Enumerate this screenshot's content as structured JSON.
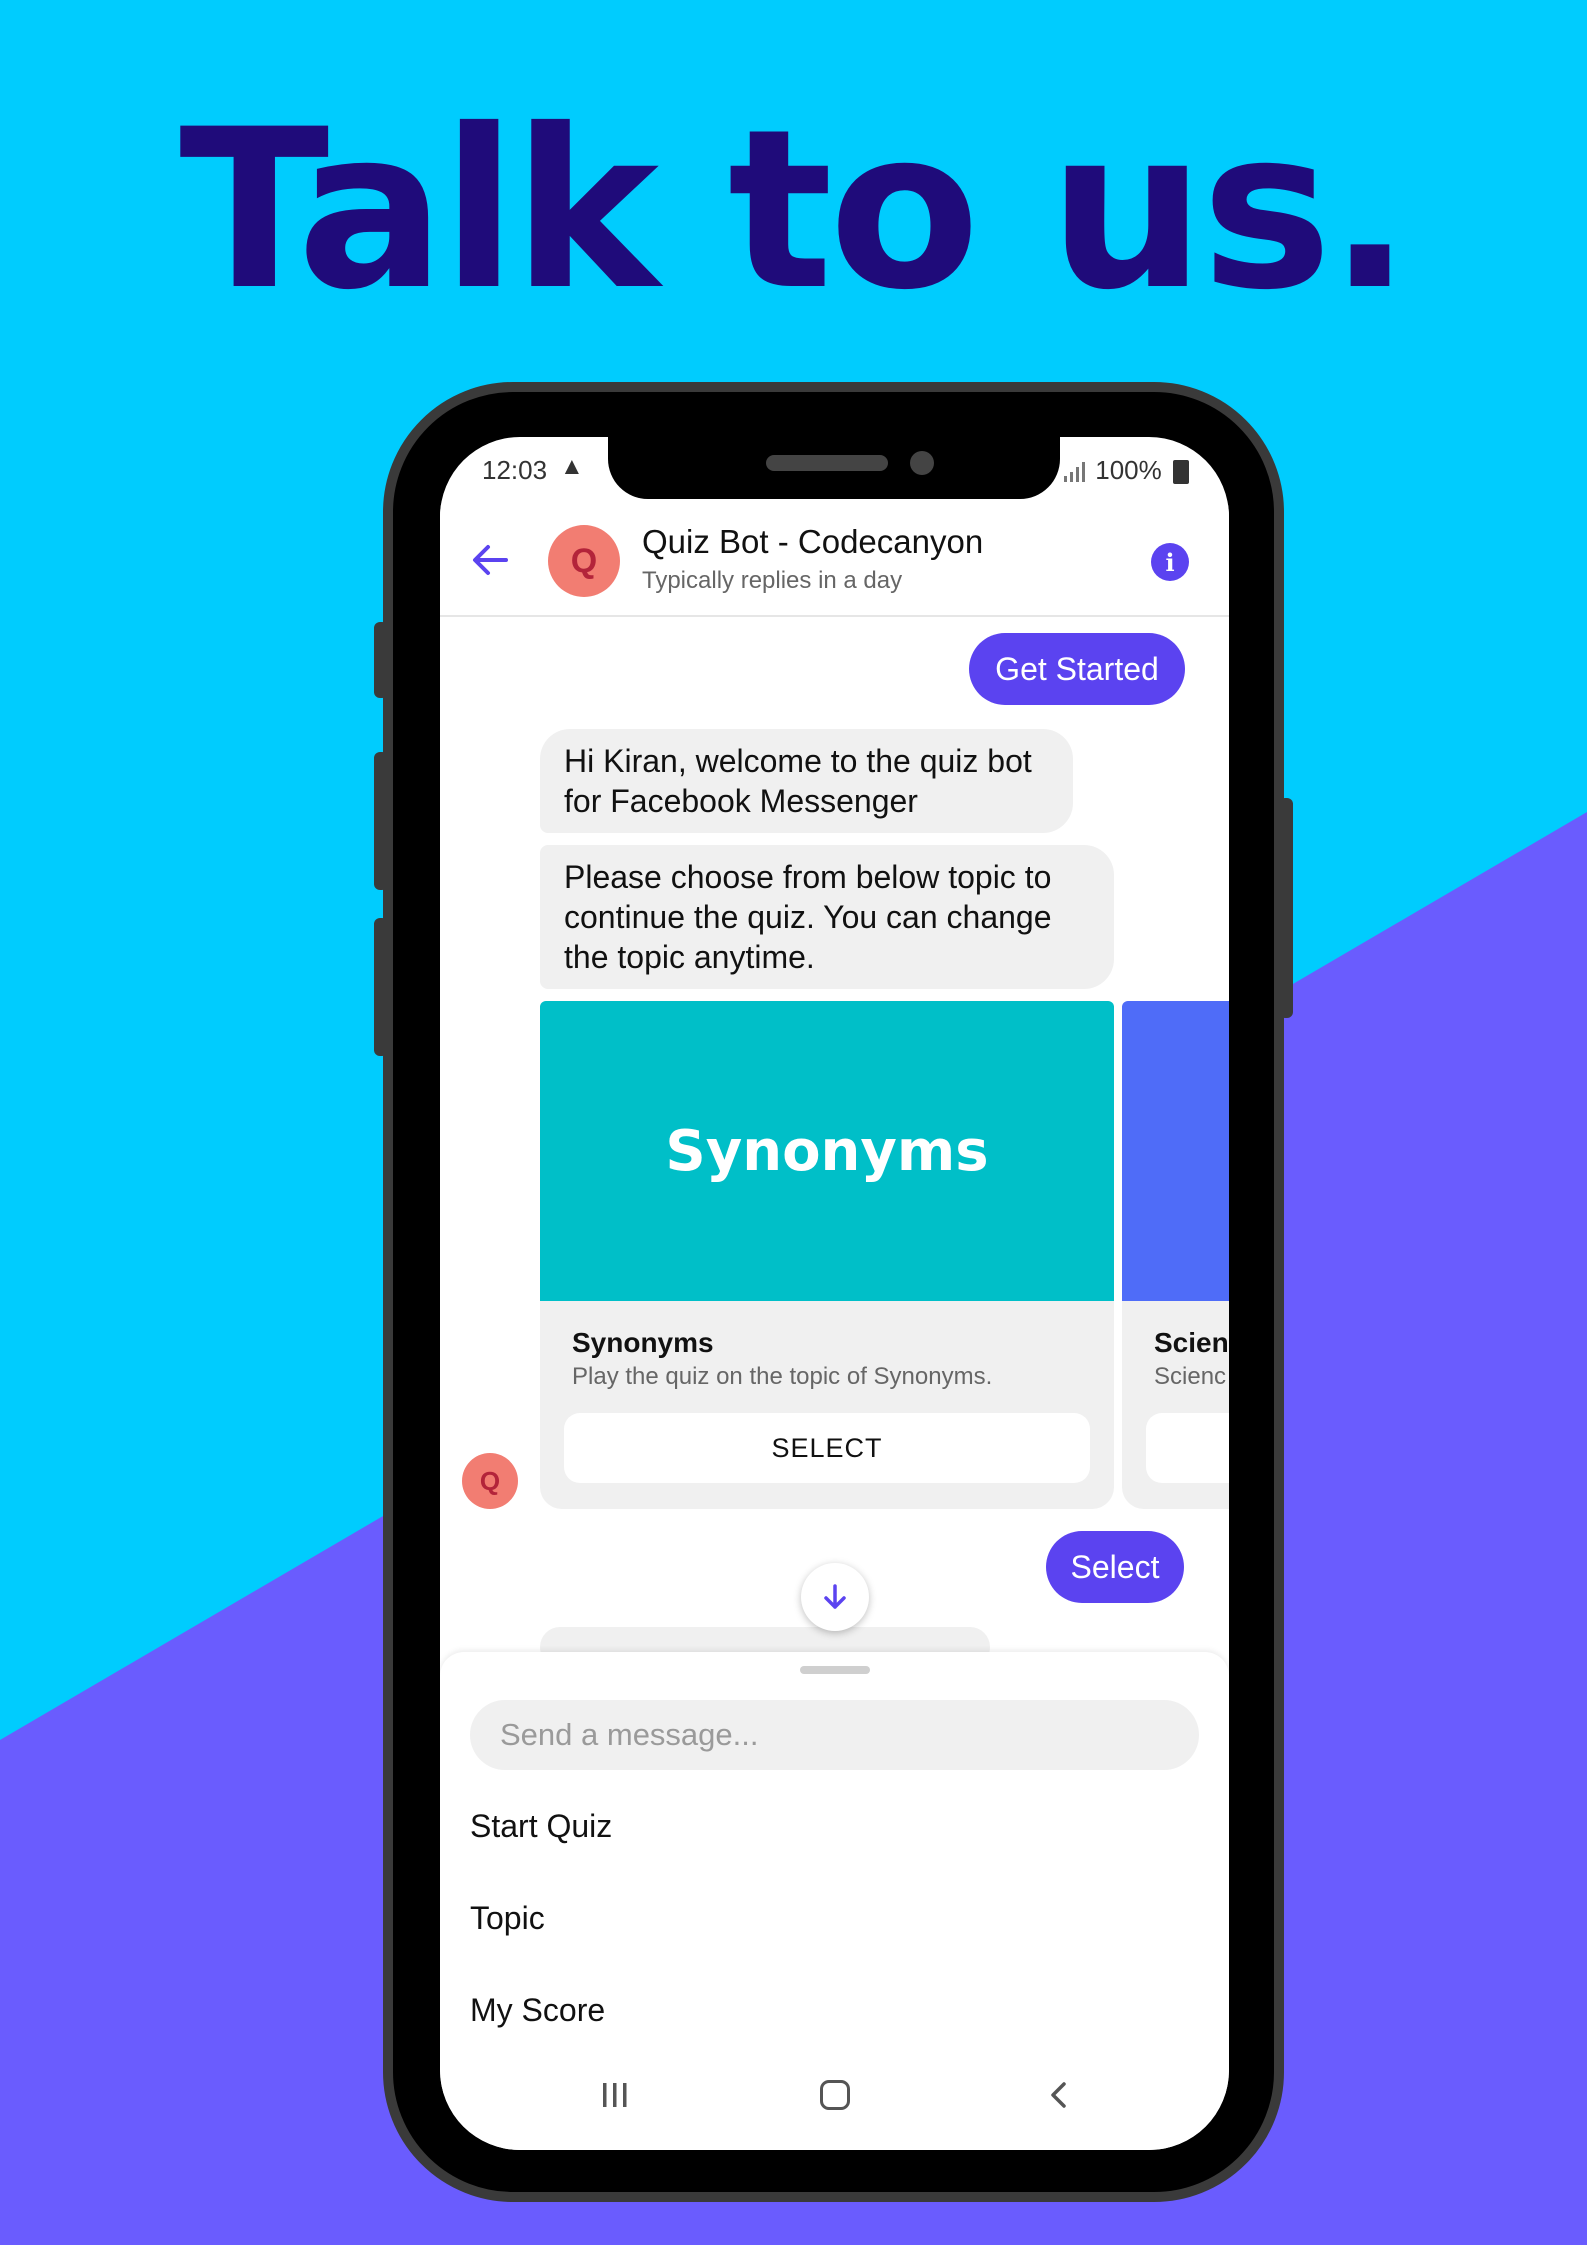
{
  "headline": "Talk to us.",
  "colors": {
    "bg_top": "#00ccfe",
    "bg_bottom": "#6a5cfe",
    "headline": "#1f0b7a",
    "accent": "#5b43f0",
    "synonyms_card": "#00bfc8",
    "science_card": "#4f6cf8",
    "avatar": "#f27d72"
  },
  "status_bar": {
    "time": "12:03",
    "battery": "100%",
    "icons": [
      "warning-icon",
      "signal-icon",
      "battery-icon"
    ]
  },
  "header": {
    "name": "Quiz Bot - Codecanyon",
    "subtitle": "Typically replies in a day",
    "avatar_letter": "Q",
    "icons": [
      "back-arrow-icon",
      "info-icon"
    ]
  },
  "messages": {
    "get_started": "Get Started",
    "welcome": "Hi Kiran, welcome to the quiz bot for Facebook Messenger",
    "choose": "Please choose from below topic to continue the quiz. You can change the topic anytime.",
    "select_reply": "Select"
  },
  "cards": [
    {
      "image_text": "Synonyms",
      "title": "Synonyms",
      "subtitle": "Play the quiz on the topic of Synonyms.",
      "button": "SELECT"
    },
    {
      "image_text": "",
      "title": "Scienc",
      "subtitle": "Scienc",
      "button": ""
    }
  ],
  "bot_avatar_letter": "Q",
  "composer": {
    "placeholder": "Send a message...",
    "value": ""
  },
  "menu": [
    "Start Quiz",
    "Topic",
    "My Score"
  ],
  "nav_bar": {
    "icons": [
      "recents-icon",
      "home-icon",
      "back-icon"
    ]
  }
}
